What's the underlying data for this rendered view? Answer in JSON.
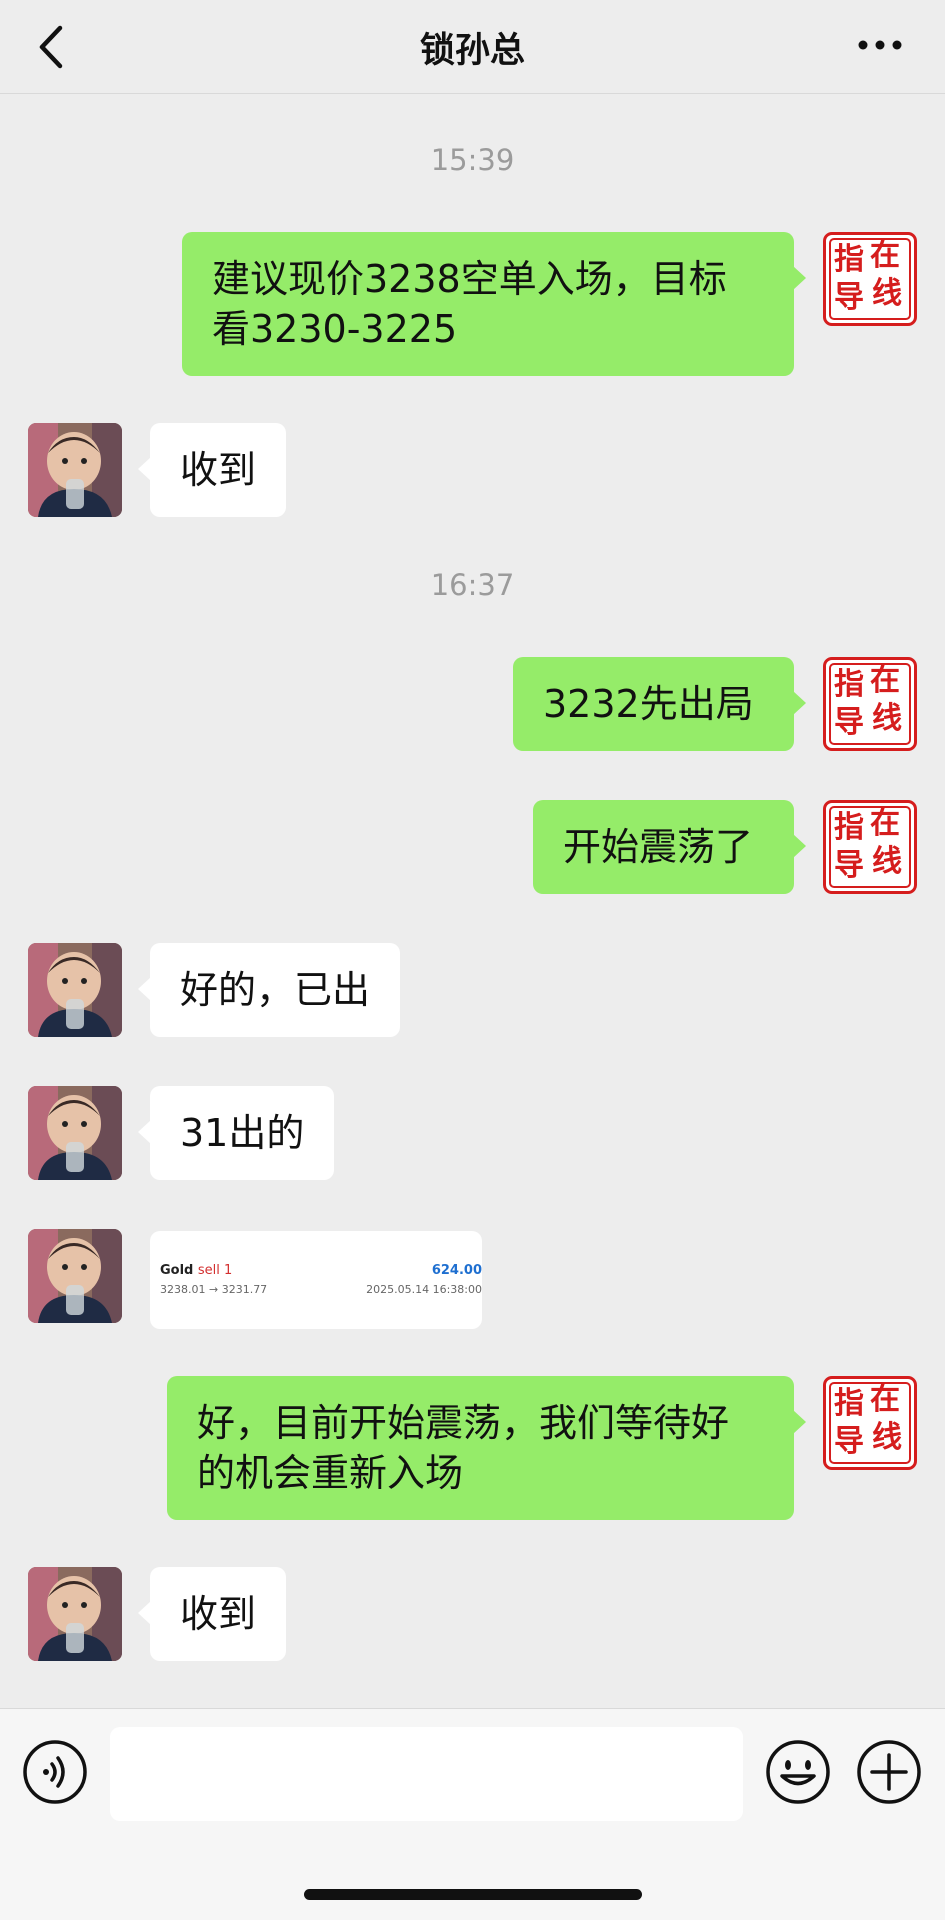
{
  "header": {
    "title": "锁孙总"
  },
  "messages": {
    "time1": "15:39",
    "m1": "建议现价3238空单入场，目标看3230-3225",
    "m2": "收到",
    "time2": "16:37",
    "m3": "3232先出局",
    "m4": "开始震荡了",
    "m5": "好的，已出",
    "m6": "31出的",
    "m8": "好，目前开始震荡，我们等待好的机会重新入场",
    "m9": "收到"
  },
  "trade_card": {
    "symbol": "Gold",
    "side": "sell 1",
    "profit": "624.00",
    "prices": "3238.01 → 3231.77",
    "datetime": "2025.05.14 16:38:00"
  },
  "seal": {
    "chars": [
      "指",
      "在",
      "导",
      "线"
    ],
    "color": "#d51d1d"
  },
  "colors": {
    "outgoing_bubble": "#95ec69",
    "incoming_bubble": "#ffffff",
    "background": "#ededed"
  },
  "icons": {
    "back": "chevron-left-icon",
    "more": "ellipsis-icon",
    "voice": "voice-icon",
    "emoji": "smiley-icon",
    "plus": "plus-icon"
  }
}
